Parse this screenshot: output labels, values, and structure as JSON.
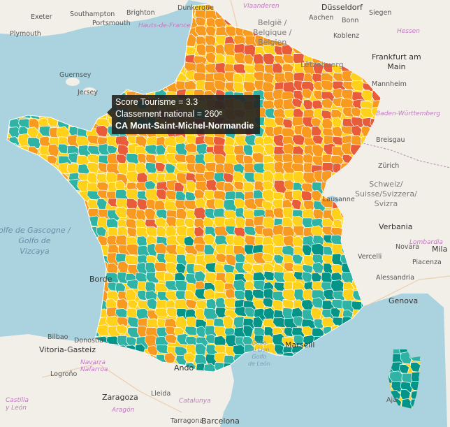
{
  "tooltip": {
    "line1": "Score Tourisme = 3.3",
    "line2": "Classement national = 260ᵉ",
    "line3": "CA Mont-Saint-Michel-Normandie"
  },
  "score_colors": {
    "very_high": "#e85c3a",
    "high": "#f79a1f",
    "medium": "#ffd11a",
    "low": "#2fb3a5",
    "very_low": "#049488"
  },
  "labels": {
    "exeter": "Exeter",
    "southampton": "Southampton",
    "brighton": "Brighton",
    "portsmouth": "Portsmouth",
    "dunkerque": "Dunkerque",
    "vlaanderen": "Vlaanderen",
    "dusseldorf": "Düsseldorf",
    "aachen": "Aachen",
    "bonn": "Bonn",
    "siegen": "Siegen",
    "plymouth": "Plymouth",
    "hauts_de_france": "Hauts-de-France",
    "belgique_1": "België /",
    "belgique_2": "Belgique /",
    "belgique_3": "Belgien",
    "koblenz": "Koblenz",
    "hessen": "Hessen",
    "frankfurt_1": "Frankfurt am",
    "frankfurt_2": "Main",
    "guernsey": "Guernsey",
    "jersey": "Jersey",
    "letzebuerg": "Lëtzebuerg",
    "mannheim": "Mannheim",
    "baden_wurttemberg": "Baden-Württemberg",
    "freiburg": "Breisgau",
    "zurich": "Zürich",
    "suisse_1": "Schweiz/",
    "suisse_2": "Suisse/Svizzera/",
    "suisse_3": "Svizra",
    "lausanne": "Lausanne",
    "golfe_1": "olfe de Gascogne /",
    "golfe_2": "Golfo de",
    "golfe_3": "Vizcaya",
    "verbania": "Verbania",
    "lombardia": "Lombardia",
    "novara": "Novara",
    "vercelli": "Vercelli",
    "milano": "Mila",
    "piacenza": "Piacenza",
    "alessandria": "Alessandria",
    "bordeaux": "Borde",
    "genova": "Genova",
    "bilbao": "Bilbao",
    "donostia": "Donostia",
    "vitoria": "Vitoria-Gasteiz",
    "navarra": "Navarra",
    "nafarroa": "Nafarroa",
    "logrono": "Logroño",
    "marseille": "Marseill",
    "golfe_lion_1": "Golfe",
    "golfe_lion_2": "du Lion",
    "golfe_lion_3": "Golfo",
    "golfe_lion_4": "de León",
    "andorra": "Ando",
    "castilla_1": "Castilla",
    "castilla_2": "y León",
    "zaragoza": "Zaragoza",
    "aragon": "Aragón",
    "catalunya": "Catalunya",
    "lleida": "Lleida",
    "barcelona": "Barcelona",
    "tarragona": "Tarragona",
    "ajaccio": "Aja"
  }
}
